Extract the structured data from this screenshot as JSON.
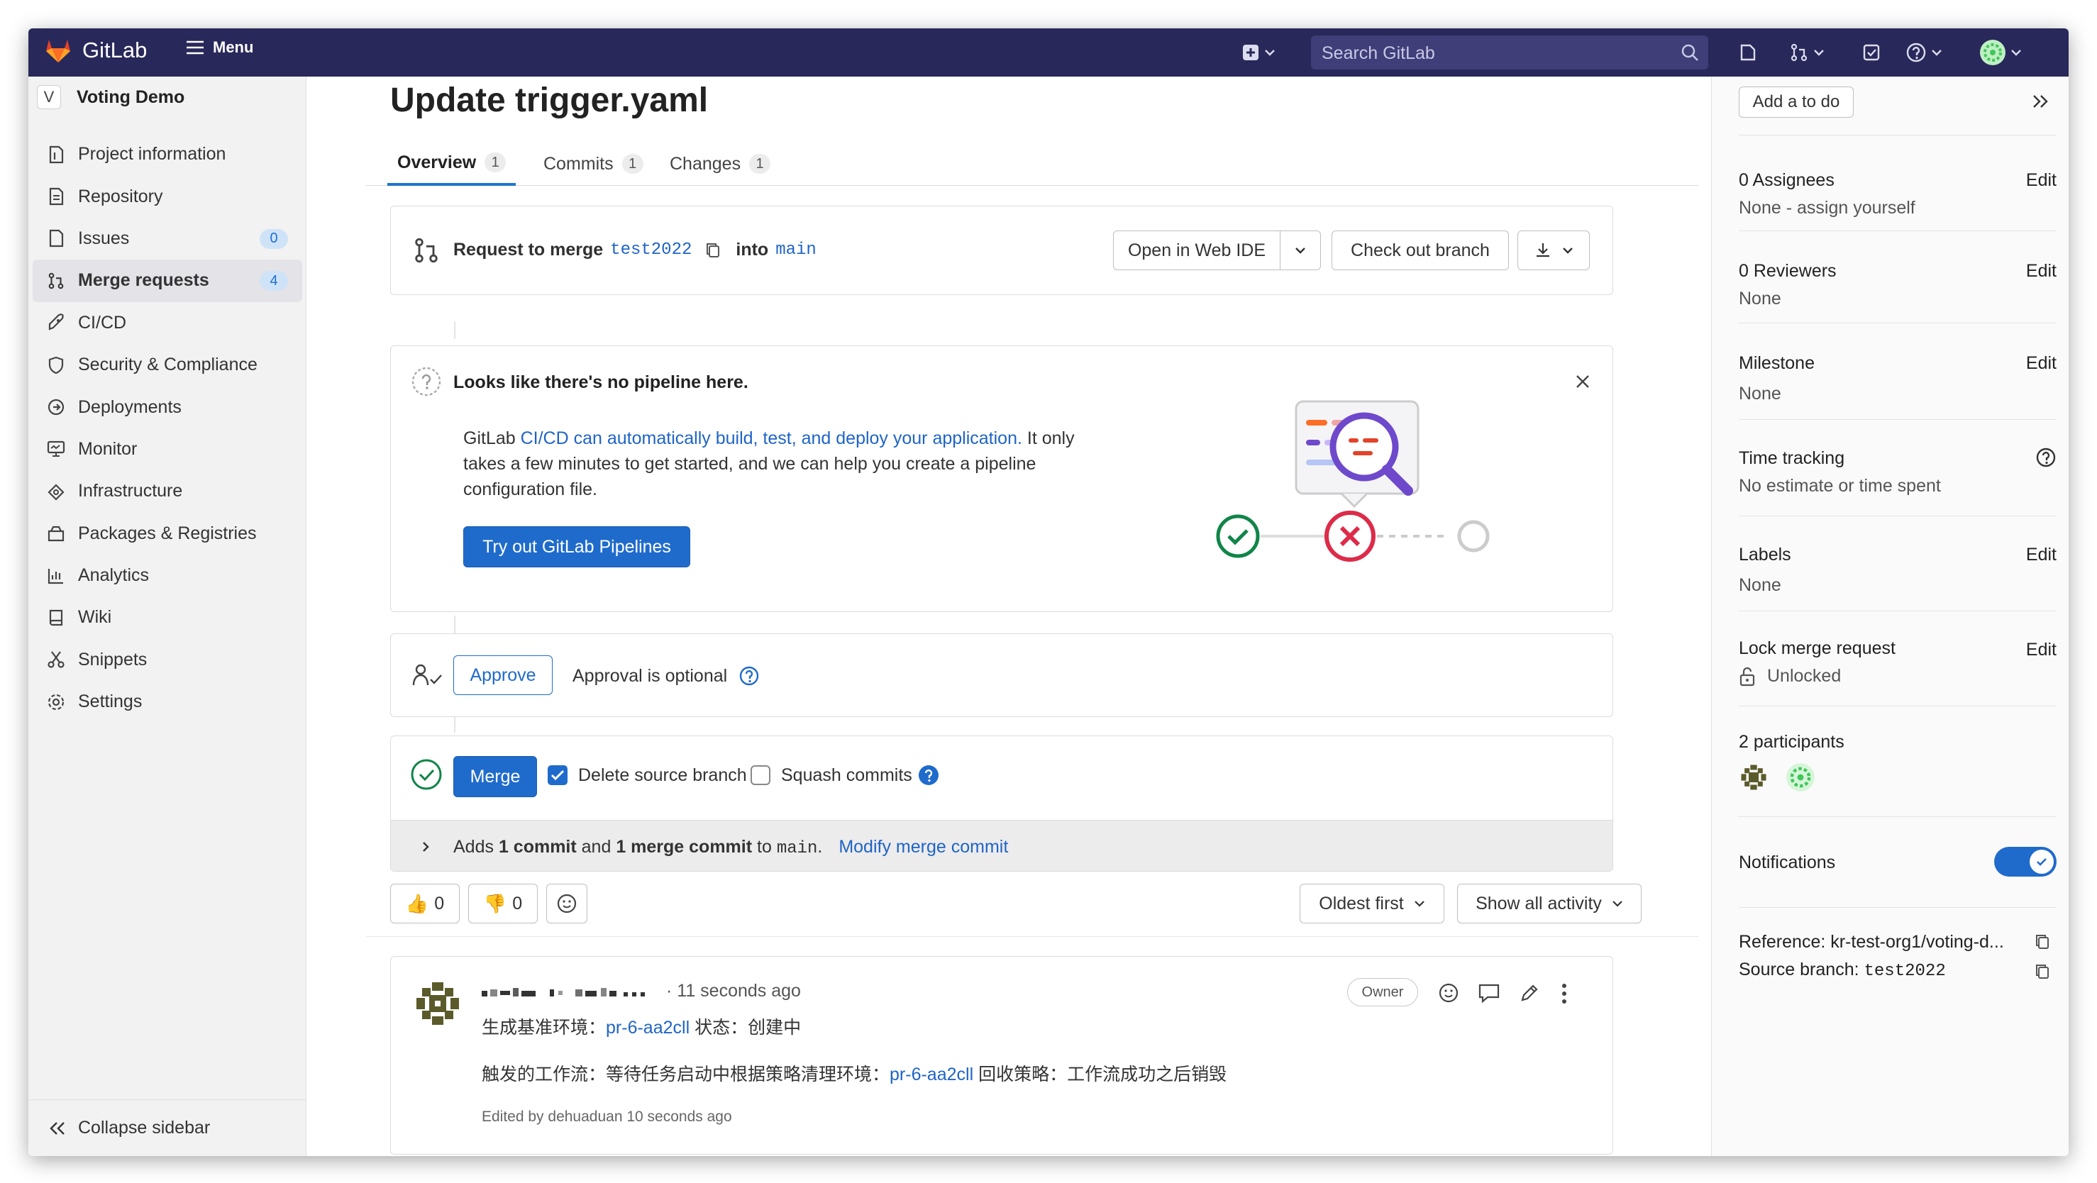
{
  "topbar": {
    "logo_text": "GitLab",
    "menu_label": "Menu",
    "search_placeholder": "Search GitLab"
  },
  "sidebar": {
    "project_avatar": "V",
    "project_name": "Voting Demo",
    "items": [
      {
        "label": "Project information",
        "icon": "info-doc-icon"
      },
      {
        "label": "Repository",
        "icon": "doc-icon"
      },
      {
        "label": "Issues",
        "icon": "issues-icon",
        "badge": "0"
      },
      {
        "label": "Merge requests",
        "icon": "merge-request-icon",
        "badge": "4",
        "active": true
      },
      {
        "label": "CI/CD",
        "icon": "rocket-icon"
      },
      {
        "label": "Security & Compliance",
        "icon": "shield-icon"
      },
      {
        "label": "Deployments",
        "icon": "deployments-icon"
      },
      {
        "label": "Monitor",
        "icon": "monitor-icon"
      },
      {
        "label": "Infrastructure",
        "icon": "cloud-gear-icon"
      },
      {
        "label": "Packages & Registries",
        "icon": "package-icon"
      },
      {
        "label": "Analytics",
        "icon": "chart-icon"
      },
      {
        "label": "Wiki",
        "icon": "book-icon"
      },
      {
        "label": "Snippets",
        "icon": "scissors-icon"
      },
      {
        "label": "Settings",
        "icon": "gear-icon"
      }
    ],
    "collapse_label": "Collapse sidebar"
  },
  "mr": {
    "title": "Update trigger.yaml",
    "tabs": [
      {
        "label": "Overview",
        "count": "1"
      },
      {
        "label": "Commits",
        "count": "1"
      },
      {
        "label": "Changes",
        "count": "1"
      }
    ],
    "request_prefix": "Request to merge",
    "source_branch": "test2022",
    "into_label": "into",
    "target_branch": "main",
    "open_web_ide": "Open in Web IDE",
    "check_out_branch": "Check out branch"
  },
  "pipeline": {
    "heading": "Looks like there's no pipeline here.",
    "text_prefix": "GitLab ",
    "text_link": "CI/CD can automatically build, test, and deploy your application.",
    "text_suffix": " It only takes a few minutes to get started, and we can help you create a pipeline configuration file.",
    "button": "Try out GitLab Pipelines"
  },
  "approval": {
    "button": "Approve",
    "text": "Approval is optional"
  },
  "merge": {
    "button": "Merge",
    "delete_source": "Delete source branch",
    "delete_source_checked": true,
    "squash": "Squash commits",
    "squash_checked": false,
    "adds_prefix": "Adds ",
    "adds_commit": "1 commit",
    "adds_and": " and ",
    "adds_merge_commit": "1 merge commit",
    "adds_to": " to ",
    "adds_branch": "main",
    "adds_dot": ".",
    "modify_link": "Modify merge commit"
  },
  "reactions": {
    "thumbs_up": "0",
    "thumbs_down": "0",
    "sort": "Oldest first",
    "filter": "Show all activity"
  },
  "comment": {
    "time": "· 11 seconds ago",
    "role": "Owner",
    "line1_prefix": "生成基准环境：",
    "line1_link": "pr-6-aa2cll",
    "line1_suffix": " 状态：创建中",
    "line2_prefix": "触发的工作流：等待任务启动中根据策略清理环境：",
    "line2_link": "pr-6-aa2cll",
    "line2_suffix": " 回收策略：工作流成功之后销毁",
    "edited": "Edited by dehuaduan 10 seconds ago"
  },
  "right_sidebar": {
    "todo": "Add a to do",
    "assignees_label": "0 Assignees",
    "assignees_value": "None - assign yourself",
    "reviewers_label": "0 Reviewers",
    "reviewers_value": "None",
    "milestone_label": "Milestone",
    "milestone_value": "None",
    "time_label": "Time tracking",
    "time_value": "No estimate or time spent",
    "labels_label": "Labels",
    "labels_value": "None",
    "lock_label": "Lock merge request",
    "lock_value": "Unlocked",
    "participants_label": "2 participants",
    "notifications_label": "Notifications",
    "notifications_on": true,
    "edit": "Edit",
    "reference_label": "Reference: kr-test-org1/voting-d...",
    "source_branch_label": "Source branch: ",
    "source_branch_value": "test2022"
  },
  "colors": {
    "topbar": "#29285a",
    "accent": "#1f6bcc",
    "success": "#108548",
    "danger": "#dd2b0e"
  }
}
